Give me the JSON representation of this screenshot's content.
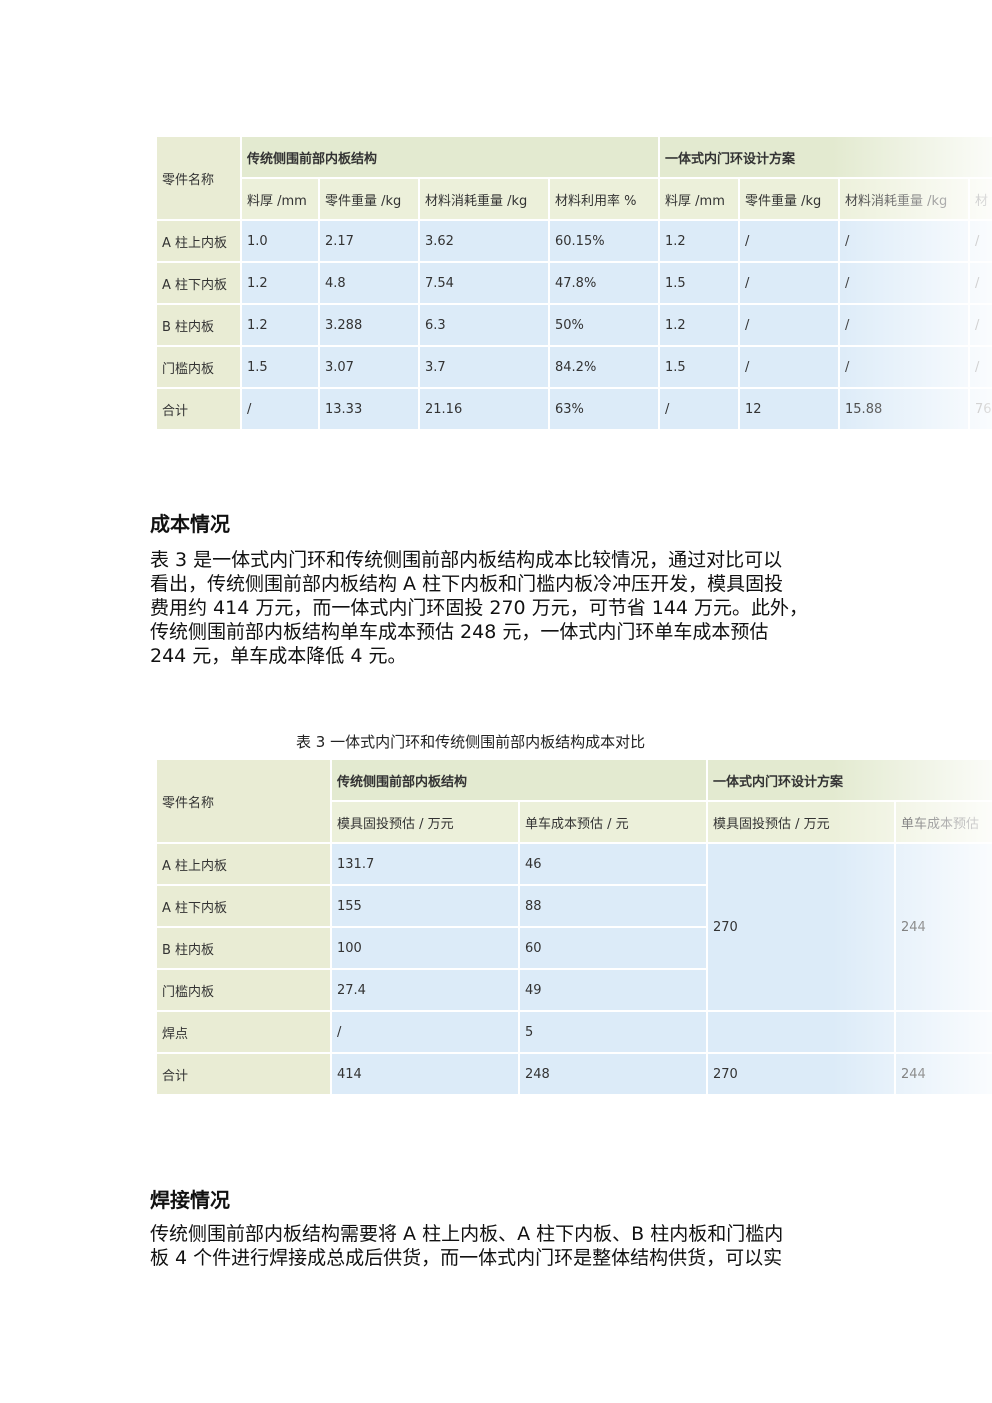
{
  "table1": {
    "part_name_header": "零件名称",
    "group_traditional": "传统侧围前部内板结构",
    "group_integrated": "一体式内门环设计方案",
    "sub_headers": [
      "料厚 /mm",
      "零件重量 /kg",
      "材料消耗重量 /kg",
      "材料利用率 %",
      "料厚 /mm",
      "零件重量 /kg",
      "材料消耗重量 /kg",
      "材"
    ],
    "rows": [
      {
        "name": "A 柱上内板",
        "cells": [
          "1.0",
          "2.17",
          "3.62",
          "60.15%",
          "1.2",
          "/",
          "/",
          "/"
        ]
      },
      {
        "name": "A 柱下内板",
        "cells": [
          "1.2",
          "4.8",
          "7.54",
          "47.8%",
          "1.5",
          "/",
          "/",
          "/"
        ]
      },
      {
        "name": "B 柱内板",
        "cells": [
          "1.2",
          "3.288",
          "6.3",
          "50%",
          "1.2",
          "/",
          "/",
          "/"
        ]
      },
      {
        "name": "门槛内板",
        "cells": [
          "1.5",
          "3.07",
          "3.7",
          "84.2%",
          "1.5",
          "/",
          "/",
          "/"
        ]
      },
      {
        "name": "合计",
        "cells": [
          "/",
          "13.33",
          "21.16",
          "63%",
          "/",
          "12",
          "15.88",
          "76"
        ]
      }
    ]
  },
  "section_cost": {
    "heading": "成本情况",
    "lines": [
      "表 3 是一体式内门环和传统侧围前部内板结构成本比较情况，通过对比可以",
      "看出，传统侧围前部内板结构 A 柱下内板和门槛内板冷冲压开发，模具固投",
      "费用约 414 万元，而一体式内门环固投 270 万元，可节省 144 万元。此外，",
      "传统侧围前部内板结构单车成本预估 248 元，一体式内门环单车成本预估",
      "244 元，单车成本降低 4 元。"
    ]
  },
  "table2": {
    "caption": "表 3 一体式内门环和传统侧围前部内板结构成本对比",
    "part_name_header": "零件名称",
    "group_traditional": "传统侧围前部内板结构",
    "group_integrated": "一体式内门环设计方案",
    "sub_headers": [
      "模具固投预估 / 万元",
      "单车成本预估 / 元",
      "模具固投预估 / 万元",
      "单车成本预估"
    ],
    "rows": [
      {
        "name": "A 柱上内板",
        "cells": [
          "131.7",
          "46"
        ]
      },
      {
        "name": "A 柱下内板",
        "cells": [
          "155",
          "88"
        ]
      },
      {
        "name": "B 柱内板",
        "cells": [
          "100",
          "60"
        ]
      },
      {
        "name": "门槛内板",
        "cells": [
          "27.4",
          "49"
        ]
      },
      {
        "name": "焊点",
        "cells": [
          "/",
          "5"
        ]
      },
      {
        "name": "合计",
        "cells": [
          "414",
          "248",
          "270",
          "244"
        ]
      }
    ],
    "merged_die_cost": "270",
    "merged_unit_cost": "244"
  },
  "section_weld": {
    "heading": "焊接情况",
    "lines": [
      "传统侧围前部内板结构需要将 A 柱上内板、A 柱下内板、B 柱内板和门槛内",
      "板 4 个件进行焊接成总成后供货，而一体式内门环是整体结构供货，可以实"
    ]
  }
}
